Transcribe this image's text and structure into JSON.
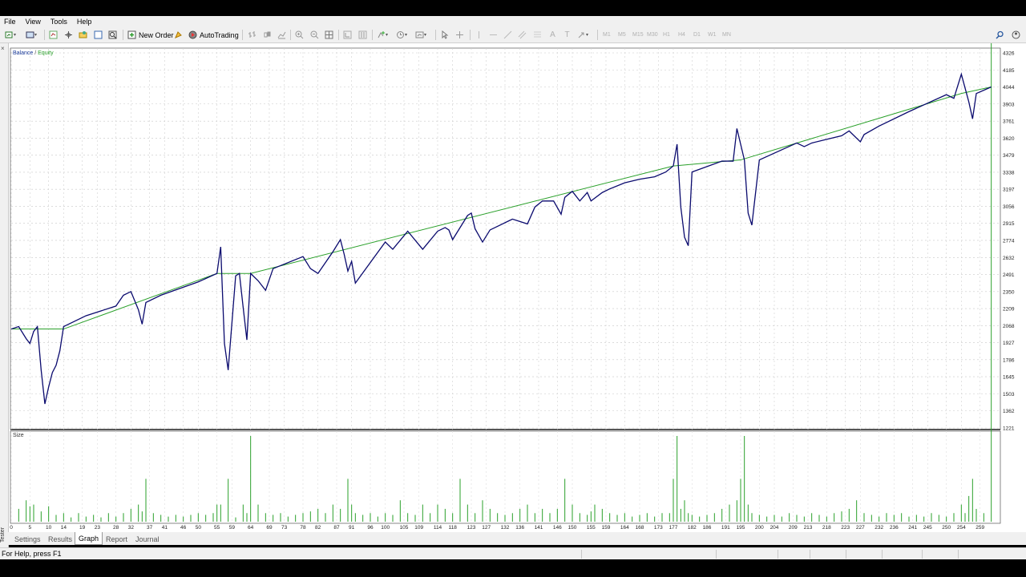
{
  "menu": [
    "File",
    "View",
    "Tools",
    "Help"
  ],
  "toolbar": {
    "new_order": "New Order",
    "autotrading": "AutoTrading",
    "timeframes": [
      "M1",
      "M5",
      "M15",
      "M30",
      "H1",
      "H4",
      "D1",
      "W1",
      "MN"
    ],
    "icons": [
      "new-chart-icon",
      "profiles-icon",
      "market-watch-icon",
      "data-window-icon",
      "navigator-icon",
      "terminal-icon",
      "strategy-tester-icon",
      "new-order-icon",
      "metaeditor-icon",
      "autotrading-icon",
      "bar-chart-icon",
      "candlestick-icon",
      "line-chart-icon",
      "zoom-in-icon",
      "zoom-out-icon",
      "tile-windows-icon",
      "auto-scroll-icon",
      "chart-shift-icon",
      "indicators-icon",
      "periods-icon",
      "templates-icon",
      "cursor-icon",
      "crosshair-icon",
      "vertical-line-icon",
      "horizontal-line-icon",
      "trendline-icon",
      "equidistant-channel-icon",
      "fibonacci-icon",
      "text-icon",
      "text-label-icon",
      "arrows-icon",
      "search-icon",
      "community-icon"
    ]
  },
  "chart": {
    "legend_balance": "Balance",
    "legend_sep": " / ",
    "legend_equity": "Equity",
    "sub_title": "Size",
    "balance_color": "#2aa02a",
    "equity_color": "#0a0a6e",
    "size_color": "#2aa02a"
  },
  "chart_data": {
    "type": "line",
    "title": "",
    "series": [
      {
        "name": "Balance",
        "x": [
          0,
          14,
          55,
          64,
          177,
          195,
          254,
          262
        ],
        "values": [
          2040,
          2040,
          2500,
          2500,
          3390,
          3440,
          3990,
          4044
        ]
      },
      {
        "name": "Equity",
        "x": [
          0,
          2,
          4,
          5,
          6,
          7,
          8,
          9,
          10,
          11,
          12,
          13,
          14,
          20,
          28,
          30,
          32,
          34,
          35,
          36,
          40,
          50,
          55,
          56,
          57,
          58,
          60,
          61,
          62,
          63,
          64,
          66,
          68,
          70,
          78,
          80,
          82,
          86,
          88,
          89,
          90,
          91,
          92,
          100,
          102,
          106,
          110,
          114,
          116,
          117,
          118,
          122,
          123,
          124,
          126,
          128,
          130,
          134,
          138,
          140,
          142,
          145,
          147,
          148,
          150,
          152,
          154,
          155,
          158,
          160,
          164,
          168,
          172,
          175,
          177,
          178,
          179,
          180,
          181,
          182,
          190,
          193,
          194,
          196,
          197,
          198,
          200,
          210,
          212,
          214,
          218,
          222,
          224,
          227,
          228,
          232,
          240,
          250,
          252,
          254,
          256,
          257,
          258,
          262
        ],
        "values": [
          2040,
          2060,
          1960,
          1920,
          2020,
          2060,
          1700,
          1420,
          1560,
          1680,
          1740,
          1860,
          2060,
          2150,
          2230,
          2320,
          2350,
          2200,
          2080,
          2260,
          2320,
          2430,
          2500,
          2720,
          1920,
          1700,
          2480,
          2500,
          2220,
          1950,
          2500,
          2440,
          2360,
          2540,
          2640,
          2540,
          2500,
          2680,
          2780,
          2660,
          2520,
          2600,
          2420,
          2760,
          2700,
          2850,
          2700,
          2850,
          2880,
          2860,
          2780,
          2980,
          3000,
          2870,
          2760,
          2860,
          2890,
          2950,
          2910,
          3050,
          3100,
          3100,
          2990,
          3130,
          3180,
          3100,
          3170,
          3100,
          3170,
          3200,
          3250,
          3280,
          3300,
          3340,
          3390,
          3570,
          3050,
          2800,
          2730,
          3340,
          3430,
          3430,
          3700,
          3440,
          3000,
          2900,
          3440,
          3580,
          3550,
          3580,
          3610,
          3640,
          3680,
          3590,
          3650,
          3720,
          3840,
          3980,
          3950,
          4150,
          3920,
          3780,
          3990,
          4044
        ]
      }
    ],
    "size_bars": {
      "x": [
        2,
        4,
        5,
        6,
        8,
        10,
        12,
        14,
        16,
        18,
        20,
        22,
        24,
        26,
        28,
        30,
        32,
        34,
        35,
        36,
        38,
        40,
        42,
        44,
        46,
        48,
        50,
        52,
        54,
        55,
        56,
        58,
        60,
        62,
        63,
        64,
        66,
        68,
        70,
        72,
        74,
        76,
        78,
        80,
        82,
        84,
        86,
        88,
        90,
        91,
        92,
        94,
        96,
        98,
        100,
        102,
        104,
        106,
        108,
        110,
        112,
        114,
        116,
        118,
        120,
        122,
        124,
        126,
        128,
        130,
        132,
        134,
        136,
        138,
        140,
        142,
        144,
        146,
        148,
        150,
        152,
        154,
        155,
        156,
        158,
        160,
        162,
        164,
        166,
        168,
        170,
        172,
        174,
        176,
        177,
        178,
        179,
        180,
        181,
        182,
        184,
        186,
        188,
        190,
        192,
        194,
        195,
        196,
        197,
        198,
        200,
        202,
        204,
        206,
        208,
        210,
        212,
        214,
        216,
        218,
        220,
        222,
        224,
        226,
        228,
        230,
        232,
        234,
        236,
        238,
        240,
        242,
        244,
        246,
        248,
        250,
        252,
        254,
        255,
        256,
        257,
        258,
        260,
        262
      ],
      "values": [
        0.15,
        0.25,
        0.18,
        0.2,
        0.12,
        0.18,
        0.08,
        0.1,
        0.05,
        0.1,
        0.06,
        0.08,
        0.05,
        0.1,
        0.06,
        0.1,
        0.15,
        0.2,
        0.12,
        0.5,
        0.1,
        0.08,
        0.06,
        0.08,
        0.06,
        0.08,
        0.1,
        0.08,
        0.1,
        0.2,
        0.2,
        0.5,
        0.05,
        0.2,
        0.1,
        1.0,
        0.2,
        0.1,
        0.08,
        0.1,
        0.06,
        0.08,
        0.1,
        0.12,
        0.15,
        0.1,
        0.2,
        0.15,
        0.5,
        0.2,
        0.1,
        0.08,
        0.1,
        0.06,
        0.1,
        0.08,
        0.25,
        0.1,
        0.08,
        0.2,
        0.1,
        0.2,
        0.15,
        0.1,
        0.5,
        0.2,
        0.1,
        0.25,
        0.15,
        0.1,
        0.08,
        0.1,
        0.15,
        0.2,
        0.1,
        0.15,
        0.1,
        0.15,
        0.5,
        0.2,
        0.1,
        0.08,
        0.12,
        0.2,
        0.15,
        0.1,
        0.08,
        0.1,
        0.06,
        0.08,
        0.1,
        0.06,
        0.1,
        0.1,
        0.5,
        1.0,
        0.15,
        0.25,
        0.1,
        0.08,
        0.06,
        0.08,
        0.1,
        0.15,
        0.2,
        0.25,
        0.5,
        1.0,
        0.2,
        0.1,
        0.08,
        0.06,
        0.08,
        0.06,
        0.1,
        0.08,
        0.06,
        0.1,
        0.08,
        0.06,
        0.1,
        0.12,
        0.15,
        0.25,
        0.1,
        0.08,
        0.06,
        0.1,
        0.08,
        0.1,
        0.06,
        0.08,
        0.06,
        0.1,
        0.08,
        0.06,
        0.1,
        0.2,
        0.1,
        0.3,
        0.5,
        0.15,
        0.1
      ],
      "ymax": 1.0
    },
    "y_ticks": [
      4326,
      4185,
      4044,
      3903,
      3761,
      3620,
      3479,
      3338,
      3197,
      3056,
      2915,
      2774,
      2632,
      2491,
      2350,
      2209,
      2068,
      1927,
      1786,
      1645,
      1503,
      1362,
      1221
    ],
    "ylim": [
      1221,
      4326
    ],
    "x_ticks": [
      0,
      5,
      10,
      14,
      19,
      23,
      28,
      32,
      37,
      41,
      46,
      50,
      55,
      59,
      64,
      69,
      73,
      78,
      82,
      87,
      91,
      96,
      100,
      105,
      109,
      114,
      118,
      123,
      127,
      132,
      136,
      141,
      146,
      150,
      155,
      159,
      164,
      168,
      173,
      177,
      182,
      186,
      191,
      195,
      200,
      204,
      209,
      213,
      218,
      223,
      227,
      232,
      236,
      241,
      245,
      250,
      254,
      259
    ],
    "xlim": [
      0,
      264
    ],
    "grid": true
  },
  "tabs": [
    "Settings",
    "Results",
    "Graph",
    "Report",
    "Journal"
  ],
  "active_tab": "Graph",
  "left_panel_label": "Tester",
  "status": {
    "help": "For Help, press F1"
  }
}
